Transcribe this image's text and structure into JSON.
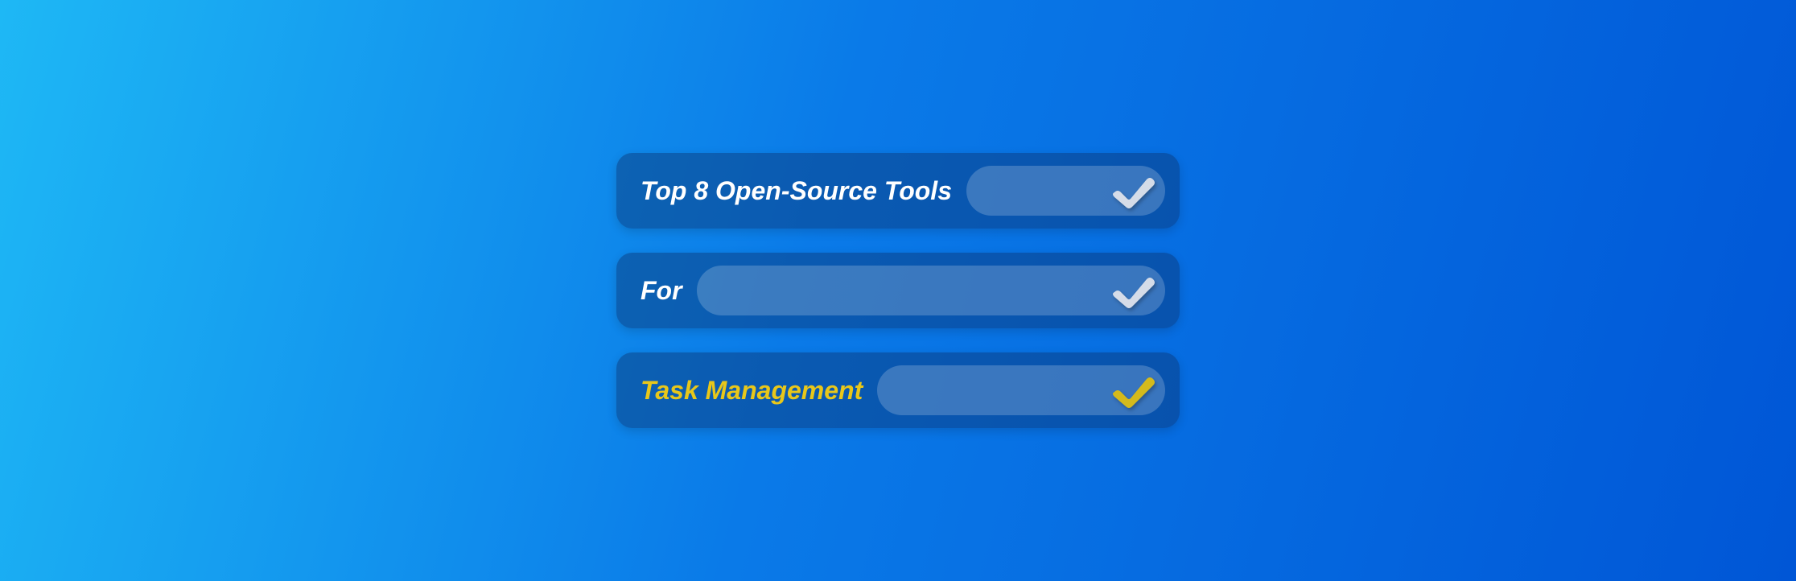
{
  "rows": [
    {
      "label": "Top 8 Open-Source Tools",
      "labelColor": "white",
      "checkColor": "white"
    },
    {
      "label": "For",
      "labelColor": "white",
      "checkColor": "white"
    },
    {
      "label": "Task Management",
      "labelColor": "yellow",
      "checkColor": "yellow"
    }
  ]
}
